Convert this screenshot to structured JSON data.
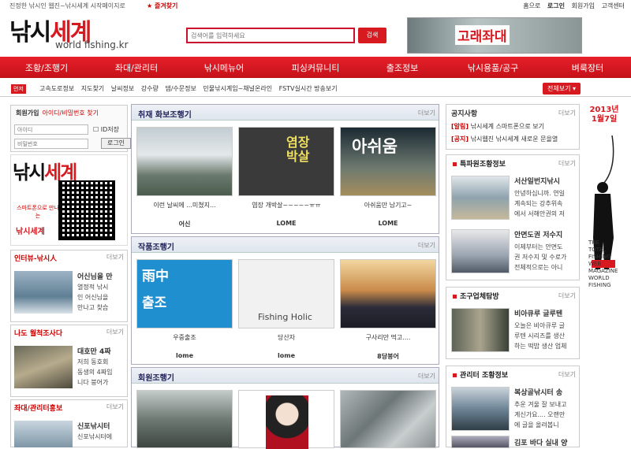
{
  "topbar": {
    "slogan": "진정한 낚시인 웹진~낚시세계 시작페이지로",
    "favorite": "★ 즐겨찾기",
    "links": [
      "홈으로",
      "로그인",
      "회원가입",
      "고객센터"
    ]
  },
  "header": {
    "logo_part1": "낚시",
    "logo_part2": "세계",
    "logo_sub": "world fishing.kr",
    "search_placeholder": "검색어를 입력하세요",
    "search_button": "검색",
    "banner_text": "고래좌대"
  },
  "nav": [
    "조황/조행기",
    "좌대/관리터",
    "낚시메뉴어",
    "피싱커뮤니티",
    "출조정보",
    "낚시용품/공구",
    "벼룩장터"
  ],
  "subnav": {
    "label": "먼저",
    "links": [
      "고속도로정보",
      "지도찾기",
      "날씨정보",
      "강수량",
      "댐/수문정보",
      "민물낚시계임~채널온라인",
      "FSTV실시간 방송보기"
    ],
    "all_button": "전체보기 ▾"
  },
  "login": {
    "tab_login": "회원가입",
    "tab_find": "아이디/비밀번호 찾기",
    "id_placeholder": "아이디",
    "pw_placeholder": "비밀번호",
    "remember": "ID저장",
    "button": "로그인"
  },
  "qr": {
    "logo1": "낚시",
    "logo2": "세계",
    "sub": "스마트폰으로 만나는",
    "name": "낚시세계"
  },
  "left_boxes": [
    {
      "title": "인터뷰-낚시人",
      "more": "더보기",
      "item_title": "어신님을 만",
      "item_desc": [
        "열정적 낚시",
        "인 어신님을",
        "만나고 찾습"
      ]
    },
    {
      "title": "나도 월척조사다",
      "more": "더보기",
      "item_title": "대호만 4짜",
      "item_desc": [
        "저희 동호회",
        "동생의 4짜입",
        "니다 붕어가"
      ]
    },
    {
      "title": "좌대/관리터홍보",
      "more": "더보기",
      "item_title": "신포낚시터",
      "item_desc": [
        "신포낚시터에"
      ]
    }
  ],
  "center": [
    {
      "title": "취재 화보조행기",
      "more": "더보기",
      "items": [
        {
          "caption": "이런 날씨에 ...미쳤지...",
          "author": "어신",
          "overlay": ""
        },
        {
          "caption": "염장 개박살~~~~~ㅠㅠ",
          "author": "LOME",
          "overlay": "염장\n박살"
        },
        {
          "caption": "아쉬움만 남기고~",
          "author": "LOME",
          "overlay": "아쉬움"
        }
      ]
    },
    {
      "title": "작품조행기",
      "more": "더보기",
      "items": [
        {
          "caption": "우중출조",
          "author": "lome",
          "overlay": "雨中\n출조"
        },
        {
          "caption": "당산자",
          "author": "lome",
          "overlay": "Fishing Holic"
        },
        {
          "caption": "구사리만 먹고....",
          "author": "8당붕어",
          "overlay": ""
        }
      ]
    },
    {
      "title": "회원조행기",
      "more": "더보기",
      "items": [
        {
          "caption": "",
          "author": "",
          "overlay": ""
        },
        {
          "caption": "",
          "author": "",
          "overlay": ""
        },
        {
          "caption": "",
          "author": "",
          "overlay": ""
        }
      ]
    }
  ],
  "notice": {
    "title": "공지사항",
    "more": "더보기",
    "items": [
      {
        "tag": "[알림]",
        "text": "낚시세계 스마트폰으로 보기"
      },
      {
        "tag": "[공지]",
        "text": "낚시웹진 낚시세계 새로운 문을열"
      }
    ]
  },
  "right_boxes": [
    {
      "title": "특파원조황정보",
      "more": "더보기",
      "items": [
        {
          "t1": "서산일번지낚시",
          "t2": [
            "안녕하십니까. 연일",
            "계속되는 강추위속",
            "에서 서해안권의 저"
          ]
        },
        {
          "t1": "안면도권 저수지",
          "t2": [
            "이제부터는 안면도",
            "권 저수지 및 수로가",
            "전체적으로는 아니"
          ]
        }
      ]
    },
    {
      "title": "조구업체탐방",
      "more": "더보기",
      "items": [
        {
          "t1": "비아큐루 글루텐",
          "t2": [
            "오늘은 비아큐루 글",
            "루텐 시리즈를 생산",
            "하는 떡밥 생산 업체"
          ]
        }
      ]
    },
    {
      "title": "관리터 조황정보",
      "more": "더보기",
      "items": [
        {
          "t1": "복상골낚시터 송",
          "t2": [
            "추운 겨울 잘 보내고",
            "계신가요.... 오랜만",
            "에 글을 올려봅니"
          ]
        },
        {
          "t1": "김포 바다 실내 양",
          "t2": []
        }
      ]
    }
  ],
  "vad": {
    "year": "2013년\n1월7일",
    "text": "THE\nTOTAL\nFISHING\nWEB\nMAGAZINE\nWORLD\nFISHING"
  }
}
